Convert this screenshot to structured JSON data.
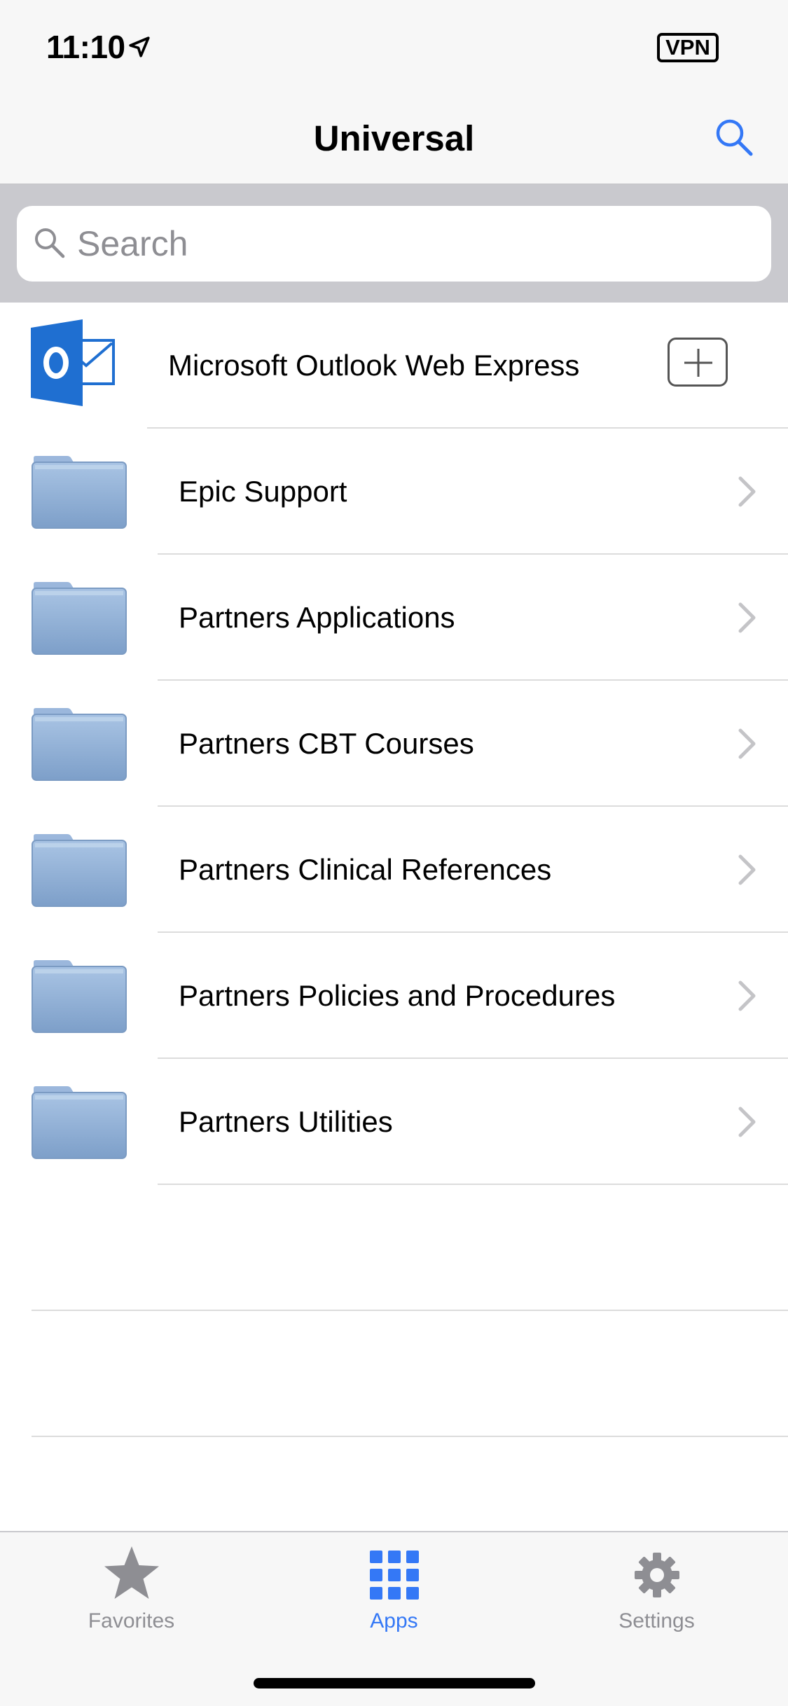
{
  "status_bar": {
    "time": "11:10",
    "location_icon": "location-arrow-icon",
    "vpn_label": "VPN"
  },
  "nav": {
    "title": "Universal",
    "search_icon": "search-icon"
  },
  "search": {
    "placeholder": "Search",
    "value": ""
  },
  "featured_app": {
    "label": "Microsoft Outlook Web Express",
    "icon": "outlook-icon",
    "action_icon": "plus-icon"
  },
  "folders": [
    {
      "label": "Epic Support",
      "icon": "folder-icon"
    },
    {
      "label": "Partners Applications",
      "icon": "folder-icon"
    },
    {
      "label": "Partners CBT Courses",
      "icon": "folder-icon"
    },
    {
      "label": "Partners Clinical References",
      "icon": "folder-icon"
    },
    {
      "label": "Partners Policies and Procedures",
      "icon": "folder-icon"
    },
    {
      "label": "Partners Utilities",
      "icon": "folder-icon"
    }
  ],
  "tabs": [
    {
      "label": "Favorites",
      "icon": "star-icon",
      "active": false
    },
    {
      "label": "Apps",
      "icon": "grid-icon",
      "active": true
    },
    {
      "label": "Settings",
      "icon": "gear-icon",
      "active": false
    }
  ],
  "colors": {
    "accent": "#3478f6",
    "inactive": "#8e8e93",
    "folder": "#8fb1d8",
    "outlook": "#1f6fd1"
  }
}
